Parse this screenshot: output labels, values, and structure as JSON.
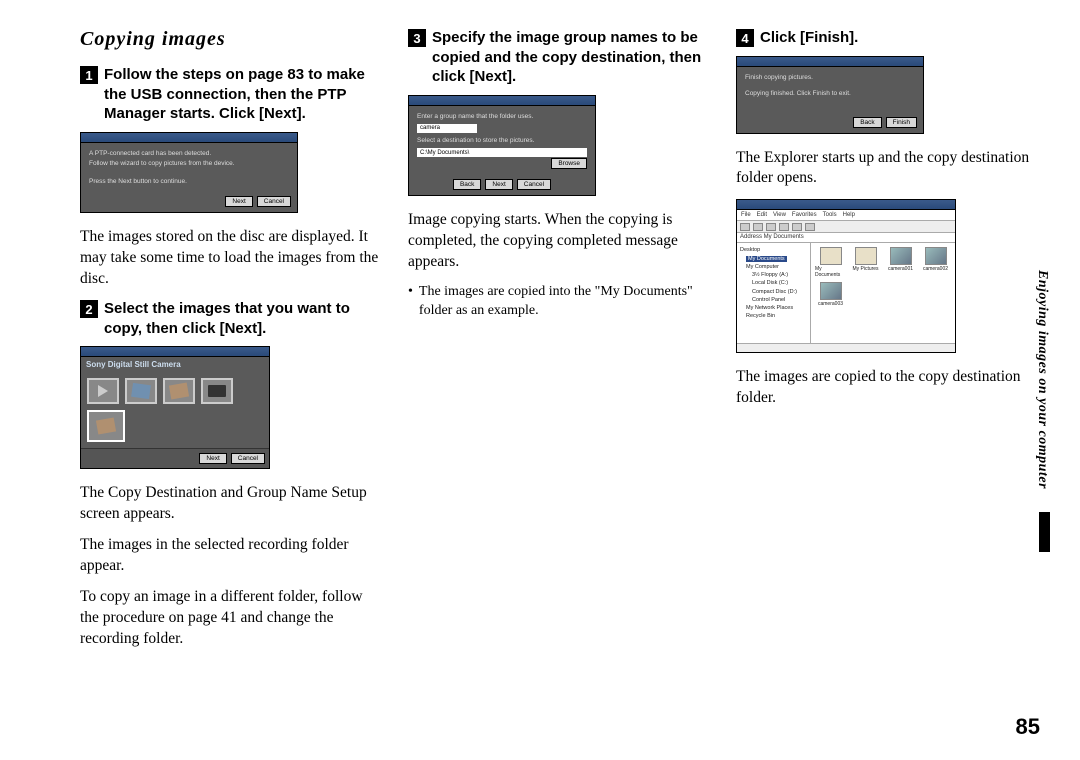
{
  "page": {
    "title": "Copying images",
    "side_label": "Enjoying images on your computer",
    "page_number": "85"
  },
  "col1": {
    "step1_num": "1",
    "step1_text": "Follow the steps on page 83 to make the USB connection, then the PTP Manager starts. Click [Next].",
    "dlg1_line1": "A PTP-connected card has been detected.",
    "dlg1_line2": "Follow the wizard to copy pictures from the device.",
    "dlg1_line3": "Press the Next button to continue.",
    "dlg1_btn_next": "Next",
    "dlg1_btn_cancel": "Cancel",
    "after1": "The images stored on the disc are displayed. It may take some time to load the images from the disc.",
    "step2_num": "2",
    "step2_text": "Select the images that you want to copy, then click [Next].",
    "thumb_title": "Sony Digital Still Camera",
    "thumb_btn_next": "Next",
    "thumb_btn_cancel": "Cancel",
    "after2a": "The Copy Destination and Group Name Setup screen appears.",
    "after2b": "The images in the selected recording folder appear.",
    "after2c": "To copy an image in a different folder, follow the procedure on page 41 and change the recording folder."
  },
  "col2": {
    "step3_num": "3",
    "step3_text": "Specify the image group names to be copied and the copy destination, then click [Next].",
    "dlg2_line1": "Enter a group name that the folder uses.",
    "dlg2_field1": "camera",
    "dlg2_line2": "Select a destination to store the pictures.",
    "dlg2_field2": "C:\\My Documents\\",
    "dlg2_btn_browse": "Browse",
    "dlg2_btn_back": "Back",
    "dlg2_btn_next": "Next",
    "dlg2_btn_cancel": "Cancel",
    "after3": "Image copying starts. When the copying is completed, the copying completed message appears.",
    "bullet3": "The images are copied into the \"My Documents\" folder as an example."
  },
  "col3": {
    "step4_num": "4",
    "step4_text": "Click [Finish].",
    "dlg3_line1": "Finish copying pictures.",
    "dlg3_line2": "Copying finished. Click Finish to exit.",
    "dlg3_btn_back": "Back",
    "dlg3_btn_finish": "Finish",
    "after4a": "The Explorer starts up and the copy destination folder opens.",
    "exp_menu_file": "File",
    "exp_menu_edit": "Edit",
    "exp_menu_view": "View",
    "exp_menu_fav": "Favorites",
    "exp_menu_tools": "Tools",
    "exp_menu_help": "Help",
    "exp_addr": "Address  My Documents",
    "exp_tree_desktop": "Desktop",
    "exp_tree_mydocs": "My Documents",
    "exp_tree_mycomp": "My Computer",
    "exp_tree_a": "3½ Floppy (A:)",
    "exp_tree_c": "Local Disk (C:)",
    "exp_tree_d": "Compact Disc (D:)",
    "exp_tree_cp": "Control Panel",
    "exp_tree_net": "My Network Places",
    "exp_tree_rb": "Recycle Bin",
    "exp_ico1": "My Documents",
    "exp_ico2": "My Pictures",
    "exp_ico3": "camera001",
    "exp_ico4": "camera002",
    "exp_ico5": "camera003",
    "after4b": "The images are copied to the copy destination folder."
  }
}
